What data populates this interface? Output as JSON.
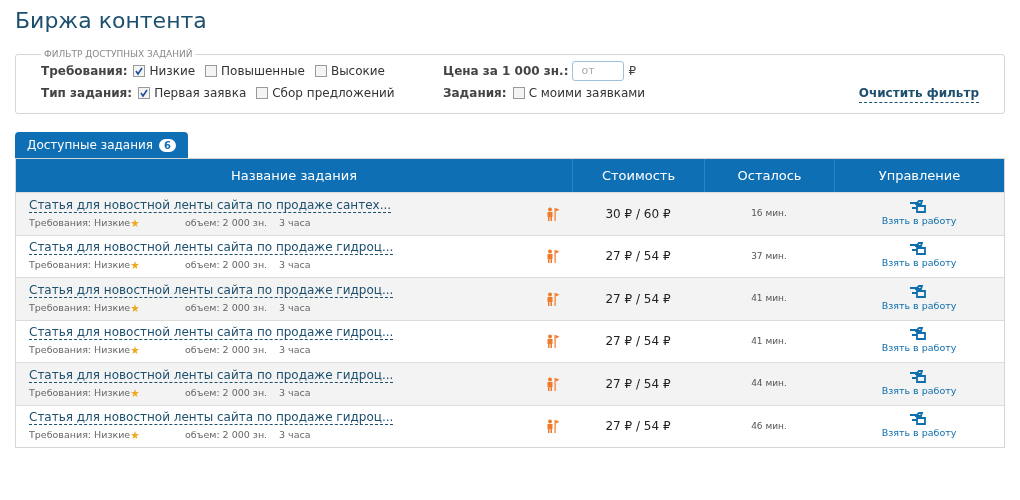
{
  "title": "Биржа контента",
  "filter": {
    "legend": "ФИЛЬТР ДОСТУПНЫХ ЗАДАНИЙ",
    "groups": [
      {
        "label": "Требования:",
        "options": [
          {
            "label": "Низкие",
            "checked": true
          },
          {
            "label": "Повышенные",
            "checked": false
          },
          {
            "label": "Высокие",
            "checked": false
          }
        ]
      },
      {
        "label": "Тип задания:",
        "options": [
          {
            "label": "Первая заявка",
            "checked": true
          },
          {
            "label": "Сбор предложений",
            "checked": false
          }
        ]
      }
    ],
    "price": {
      "label": "Цена за 1 000 зн.:",
      "placeholder": "от",
      "unit": "₽"
    },
    "tasks": {
      "label": "Задания:",
      "options": [
        {
          "label": "С моими заявками",
          "checked": false
        }
      ]
    },
    "clear": "Очистить фильтр"
  },
  "tabs": [
    {
      "label": "Доступные задания",
      "count": "6",
      "selected": true
    }
  ],
  "table": {
    "columns": [
      "Название задания",
      "Стоимость",
      "Осталось",
      "Управление"
    ],
    "rows": [
      {
        "title": "Статья для новостной ленты сайта по продаже сантех...",
        "requirements": "Требования: Низкие",
        "volume": "объем: 2 000 зн.",
        "duration": "3 часа",
        "price": "30 ₽ / 60 ₽",
        "left": "16 мин.",
        "action": "Взять в работу"
      },
      {
        "title": "Статья для новостной ленты сайта по продаже гидроц...",
        "requirements": "Требования: Низкие",
        "volume": "объем: 2 000 зн.",
        "duration": "3 часа",
        "price": "27 ₽ / 54 ₽",
        "left": "37 мин.",
        "action": "Взять в работу"
      },
      {
        "title": "Статья для новостной ленты сайта по продаже гидроц...",
        "requirements": "Требования: Низкие",
        "volume": "объем: 2 000 зн.",
        "duration": "3 часа",
        "price": "27 ₽ / 54 ₽",
        "left": "41 мин.",
        "action": "Взять в работу"
      },
      {
        "title": "Статья для новостной ленты сайта по продаже гидроц...",
        "requirements": "Требования: Низкие",
        "volume": "объем: 2 000 зн.",
        "duration": "3 часа",
        "price": "27 ₽ / 54 ₽",
        "left": "41 мин.",
        "action": "Взять в работу"
      },
      {
        "title": "Статья для новостной ленты сайта по продаже гидроц...",
        "requirements": "Требования: Низкие",
        "volume": "объем: 2 000 зн.",
        "duration": "3 часа",
        "price": "27 ₽ / 54 ₽",
        "left": "44 мин.",
        "action": "Взять в работу"
      },
      {
        "title": "Статья для новостной ленты сайта по продаже гидроц...",
        "requirements": "Требования: Низкие",
        "volume": "объем: 2 000 зн.",
        "duration": "3 часа",
        "price": "27 ₽ / 54 ₽",
        "left": "46 мин.",
        "action": "Взять в работу"
      }
    ]
  }
}
